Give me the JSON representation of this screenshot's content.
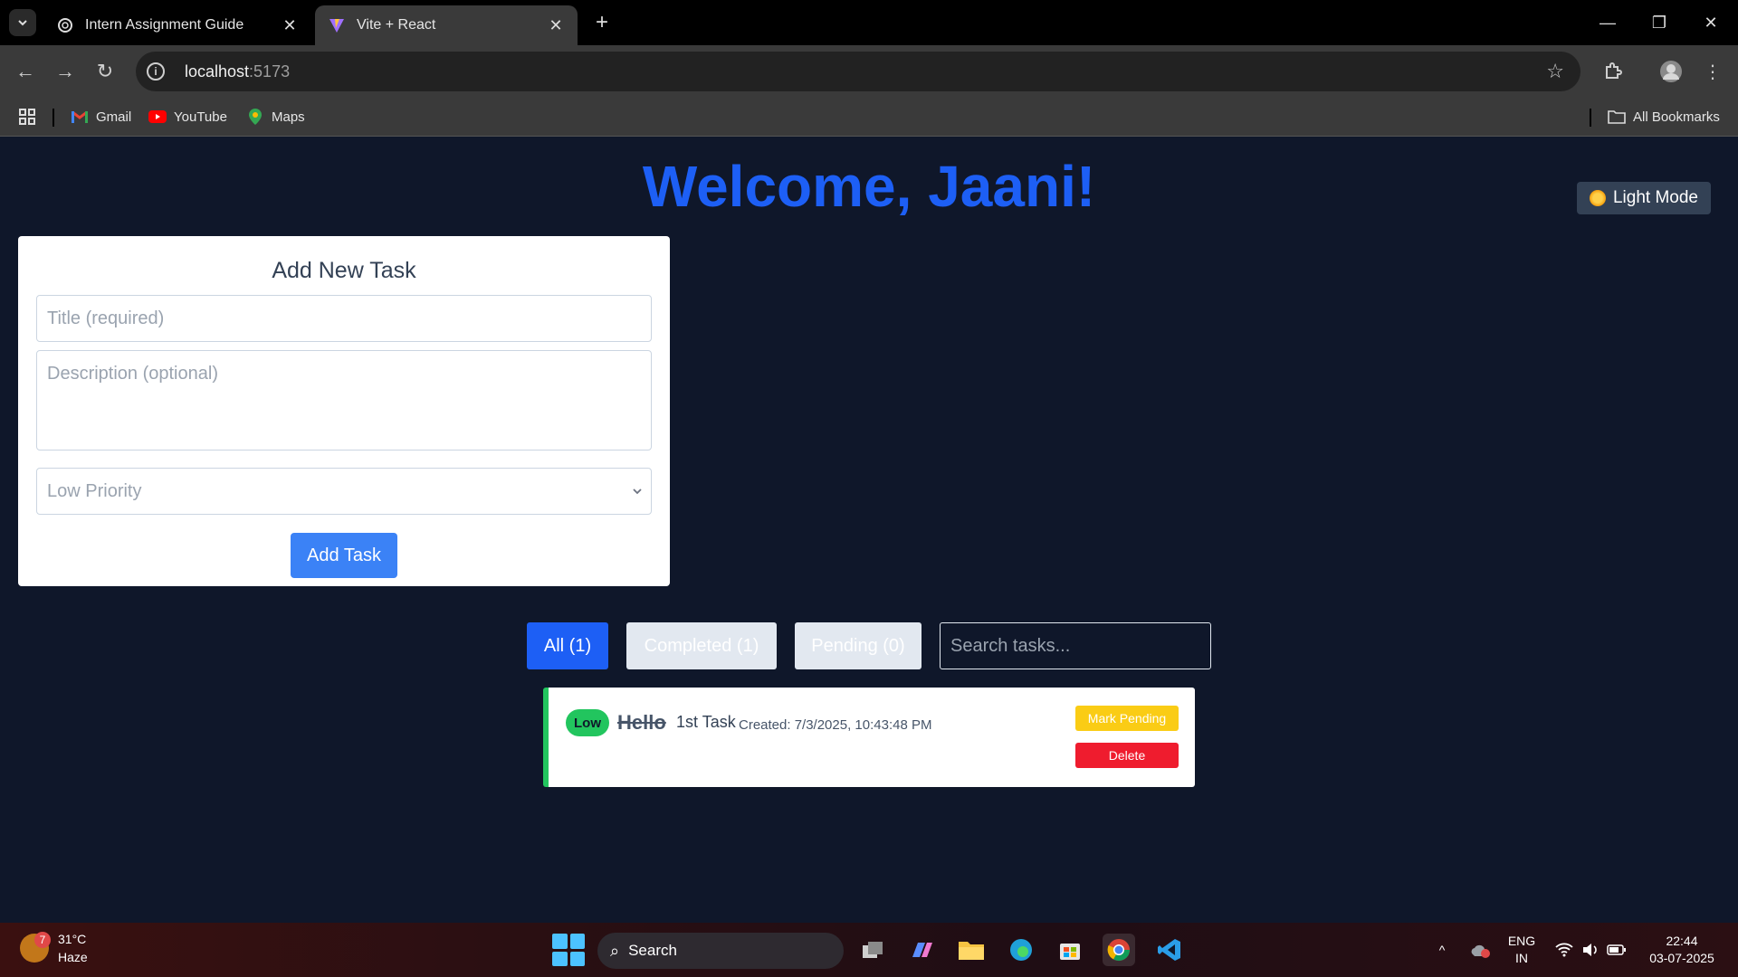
{
  "browser": {
    "tabs": [
      {
        "title": "Intern Assignment Guide",
        "icon": "openai-icon"
      },
      {
        "title": "Vite + React",
        "icon": "vite-icon"
      }
    ],
    "url_host": "localhost",
    "url_port": ":5173",
    "bookmarks": [
      "Gmail",
      "YouTube",
      "Maps"
    ],
    "all_bookmarks": "All Bookmarks"
  },
  "app": {
    "welcome": "Welcome, Jaani!",
    "theme_toggle": "Light Mode",
    "form": {
      "heading": "Add New Task",
      "title_placeholder": "Title (required)",
      "description_placeholder": "Description (optional)",
      "priority_value": "Low Priority",
      "submit_label": "Add Task"
    },
    "filters": {
      "all": "All (1)",
      "completed": "Completed (1)",
      "pending": "Pending (0)",
      "search_placeholder": "Search tasks..."
    },
    "tasks": [
      {
        "priority": "Low",
        "title": "Hello",
        "description": "1st Task",
        "created": "Created: 7/3/2025, 10:43:48 PM",
        "toggle_label": "Mark Pending",
        "delete_label": "Delete",
        "completed": true
      }
    ],
    "colors": {
      "background": "#0f172a",
      "accent": "#1d5ff5",
      "completed_border": "#22c55e",
      "mark_pending": "#facc15",
      "delete": "#ef1c2e"
    }
  },
  "taskbar": {
    "weather_temp": "31°C",
    "weather_desc": "Haze",
    "weather_badge": "7",
    "search_label": "Search",
    "lang_line1": "ENG",
    "lang_line2": "IN",
    "time": "22:44",
    "date": "03-07-2025"
  }
}
